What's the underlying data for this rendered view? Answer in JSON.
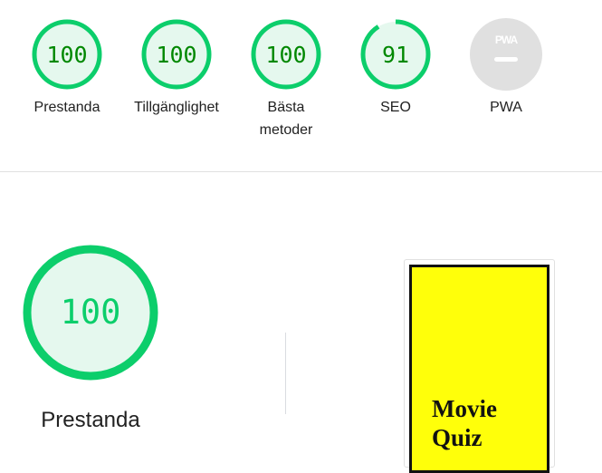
{
  "colors": {
    "pass_stroke": "#0cce6b",
    "pass_fill": "#e5f8ee",
    "pass_text": "#008800",
    "big_text": "#0cce6b",
    "na_fill": "#e0e0e0",
    "na_mark": "#ffffff",
    "thumb_bg": "#ffff0a"
  },
  "gauges": [
    {
      "label": "Prestanda",
      "score": "100",
      "score_value": 100
    },
    {
      "label": "Tillgänglighet",
      "score": "100",
      "score_value": 100
    },
    {
      "label": "Bästa metoder",
      "score": "100",
      "score_value": 100
    },
    {
      "label": "SEO",
      "score": "91",
      "score_value": 91
    },
    {
      "label": "PWA",
      "badge_text": "PWA",
      "icon": "pwa-icon"
    }
  ],
  "category": {
    "score": "100",
    "score_value": 100,
    "title": "Prestanda"
  },
  "screenshot": {
    "title": "Movie Quiz"
  }
}
